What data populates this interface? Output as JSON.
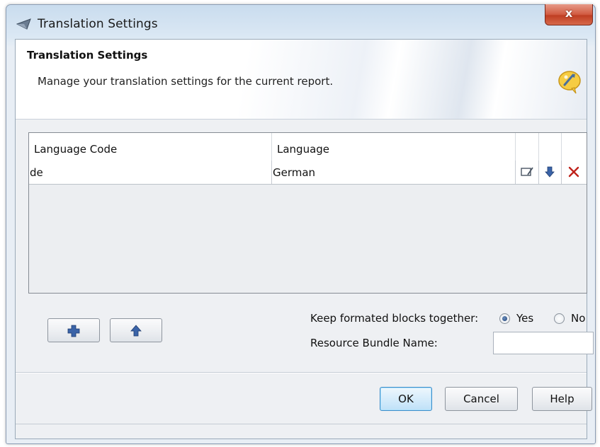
{
  "window": {
    "title": "Translation Settings",
    "close_label": "x"
  },
  "banner": {
    "title": "Translation Settings",
    "description": "Manage your translation settings for the current report."
  },
  "table": {
    "columns": [
      "Language Code",
      "Language"
    ],
    "rows": [
      {
        "code": "de",
        "language": "German"
      }
    ]
  },
  "options": {
    "keep_blocks_label": "Keep formated blocks together:",
    "yes_label": "Yes",
    "no_label": "No",
    "keep_blocks_value": "Yes",
    "bundle_label": "Resource Bundle Name:",
    "bundle_value": ""
  },
  "buttons": {
    "ok": "OK",
    "cancel": "Cancel",
    "help": "Help"
  },
  "icons": {
    "title": "translation-settings-icon",
    "banner": "translate-bubble-icon",
    "edit": "edit-icon",
    "move_down": "arrow-down-icon",
    "delete": "delete-icon",
    "add": "add-icon",
    "move_up": "arrow-up-icon"
  },
  "colors": {
    "accent": "#2d5f9e",
    "delete": "#c0221b",
    "close": "#c94a2f"
  }
}
